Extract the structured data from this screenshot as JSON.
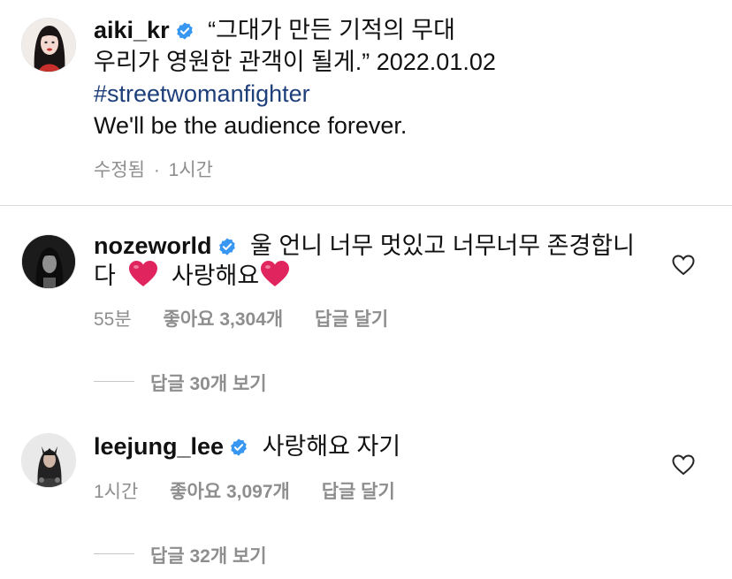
{
  "post": {
    "username": "aiki_kr",
    "caption_line1": "“그대가 만든 기적의 무대",
    "caption_line2": "우리가 영원한 관객이 될게.” 2022.01.02",
    "hashtag": "#streetwomanfighter",
    "caption_line4": "We'll be the audience forever.",
    "edited_label": "수정됨",
    "separator": "·",
    "time": "1시간"
  },
  "comments": [
    {
      "username": "nozeworld",
      "text_line1": "울 언니 너무 멋있고 너무너무 존경합니",
      "text_line2_a": "다",
      "text_line2_b": "사랑해요",
      "time": "55분",
      "likes": "좋아요 3,304개",
      "reply": "답글 달기",
      "view_replies": "답글 30개 보기"
    },
    {
      "username": "leejung_lee",
      "text_line1": "사랑해요 자기",
      "time": "1시간",
      "likes": "좋아요 3,097개",
      "reply": "답글 달기",
      "view_replies": "답글 32개 보기"
    }
  ],
  "colors": {
    "verified": "#3897f0",
    "hashtag": "#1d3f7a",
    "muted": "#8e8e8e",
    "heart_emoji": "#e0245e"
  },
  "icons": {
    "verified": "verified-badge-icon",
    "like": "heart-outline-icon",
    "emoji": "red-heart-emoji"
  }
}
